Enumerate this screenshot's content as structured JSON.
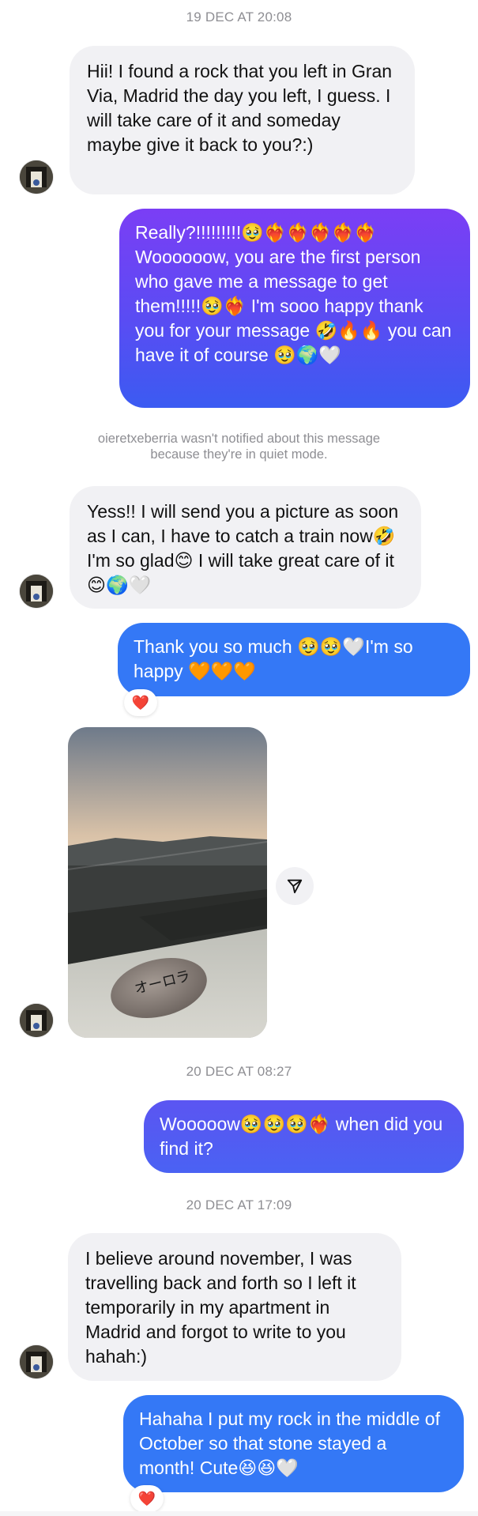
{
  "timestamps": [
    "19 DEC AT 20:08",
    "20 DEC AT 08:27",
    "20 DEC AT 17:09"
  ],
  "messages": [
    {
      "side": "in",
      "text": "Hii! I found a rock that you left in Gran Via, Madrid the day you left, I guess. I will take care of it and someday maybe give it back to you?:)"
    },
    {
      "side": "out",
      "text": "Really?!!!!!!!!!🥹❤️‍🔥❤️‍🔥❤️‍🔥❤️‍🔥❤️‍🔥 Woooooow, you are the first person who gave me a message to get them!!!!!🥹❤️‍🔥 I'm sooo happy thank you for your message 🤣🔥🔥 you can have it of course 🥹🌍🤍"
    },
    {
      "side": "in",
      "text": "Yess!! I will send you a picture as soon as I can, I have to catch a train now🤣 I'm so glad😊 I will take great care of it 😊🌍🤍"
    },
    {
      "side": "out",
      "text": "Thank you so much 🥹🥹🤍I'm so happy 🧡🧡🧡",
      "reaction": "❤️"
    },
    {
      "side": "out",
      "text": "Wooooow🥹🥹🥹❤️‍🔥 when did you find it?"
    },
    {
      "side": "in",
      "text": "I believe around november, I was travelling back and forth so I left it temporarily in my apartment in Madrid and forgot to write to you hahah:)"
    },
    {
      "side": "out",
      "text": "Hahaha I put my rock in the middle of October so that stone stayed a month! Cute😆😆🤍",
      "reaction": "❤️"
    }
  ],
  "notice": "oieretxeberria wasn't notified about this message\nbecause they're in quiet mode.",
  "photo": {
    "stone_text": "オーロラ",
    "icons": [
      "rock-photo",
      "share-icon"
    ]
  },
  "colors": {
    "incoming_bg": "#f1f1f4",
    "outgoing_blue": "#3478f6",
    "outgoing_purple": "#7b3ef5",
    "timestamp": "#8e8e93"
  }
}
